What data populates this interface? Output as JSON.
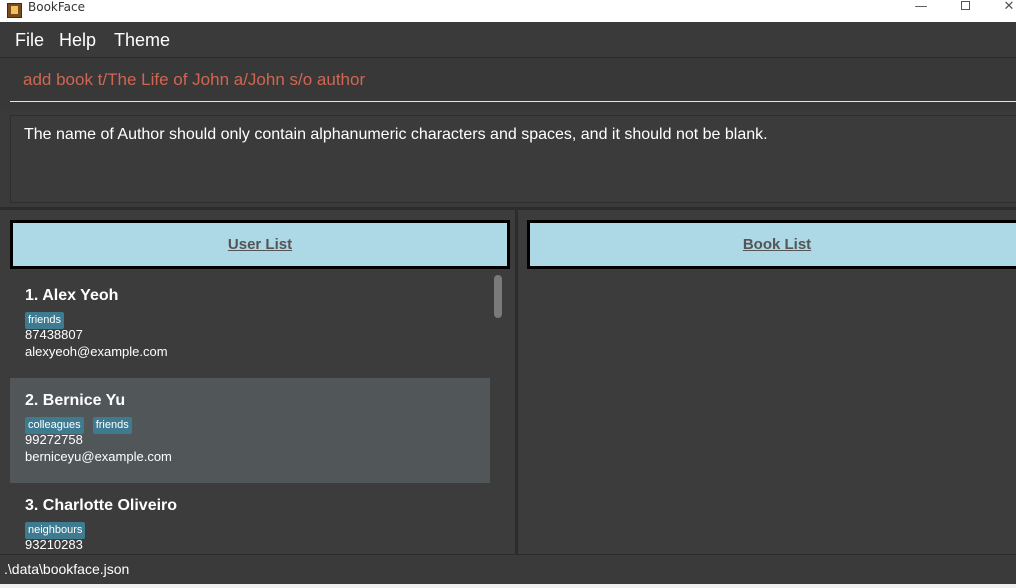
{
  "window": {
    "title": "BookFace",
    "minimize_glyph": "—",
    "close_glyph": "✕"
  },
  "menu": {
    "items": [
      "File",
      "Help",
      "Theme"
    ]
  },
  "command": {
    "value": "add book t/The Life of John a/John s/o author"
  },
  "result": {
    "message": "The name of Author should only contain alphanumeric characters and spaces, and it should not be blank."
  },
  "panels": {
    "user_list_title": "User List",
    "book_list_title": "Book List"
  },
  "users": [
    {
      "name": "1.  Alex Yeoh",
      "tags": [
        "friends"
      ],
      "phone": "87438807",
      "email": "alexyeoh@example.com"
    },
    {
      "name": "2.  Bernice Yu",
      "tags": [
        "colleagues",
        "friends"
      ],
      "phone": "99272758",
      "email": "berniceyu@example.com"
    },
    {
      "name": "3.  Charlotte Oliveiro",
      "tags": [
        "neighbours"
      ],
      "phone": "93210283",
      "email": ""
    }
  ],
  "status": {
    "file_path": ".\\data\\bookface.json"
  },
  "colors": {
    "command_text": "#d06651",
    "panel_header_bg": "#add8e6",
    "tag_bg": "#3e7b91",
    "selected_row_bg": "#515658"
  },
  "icons": {
    "app": "book-icon",
    "minimize": "minimize-icon",
    "maximize": "maximize-icon",
    "close": "close-icon"
  }
}
